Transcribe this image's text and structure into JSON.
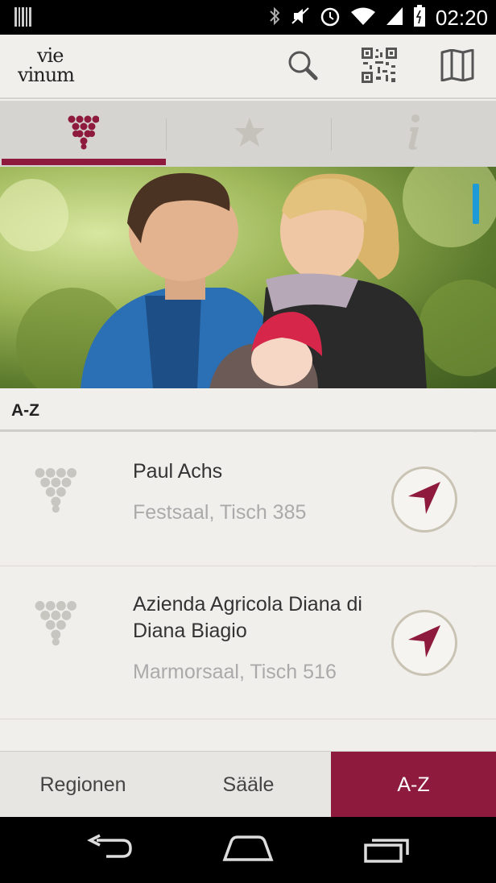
{
  "status_bar": {
    "time": "02:20",
    "icons": [
      "barcode-icon",
      "bluetooth-icon",
      "mute-icon",
      "alarm-icon",
      "wifi-icon",
      "signal-icon",
      "battery-icon"
    ]
  },
  "app_bar": {
    "logo_line1": "vie",
    "logo_line2": "vinum",
    "actions": [
      "search-icon",
      "qr-code-icon",
      "map-icon"
    ]
  },
  "tabs": [
    {
      "icon": "grapes-icon",
      "selected": true
    },
    {
      "icon": "star-icon",
      "selected": false
    },
    {
      "icon": "info-icon",
      "selected": false
    }
  ],
  "section": {
    "title": "A-Z"
  },
  "list": [
    {
      "name": "Paul Achs",
      "location": "Festsaal, Tisch 385"
    },
    {
      "name": "Azienda Agricola Diana di Diana Biagio",
      "location": "Marmorsaal, Tisch 516"
    }
  ],
  "bottom_tabs": [
    {
      "label": "Regionen",
      "selected": false
    },
    {
      "label": "Sääle",
      "selected": false
    },
    {
      "label": "A-Z",
      "selected": true
    }
  ],
  "colors": {
    "accent": "#8e1a3d",
    "scroll": "#1e9bd7"
  }
}
